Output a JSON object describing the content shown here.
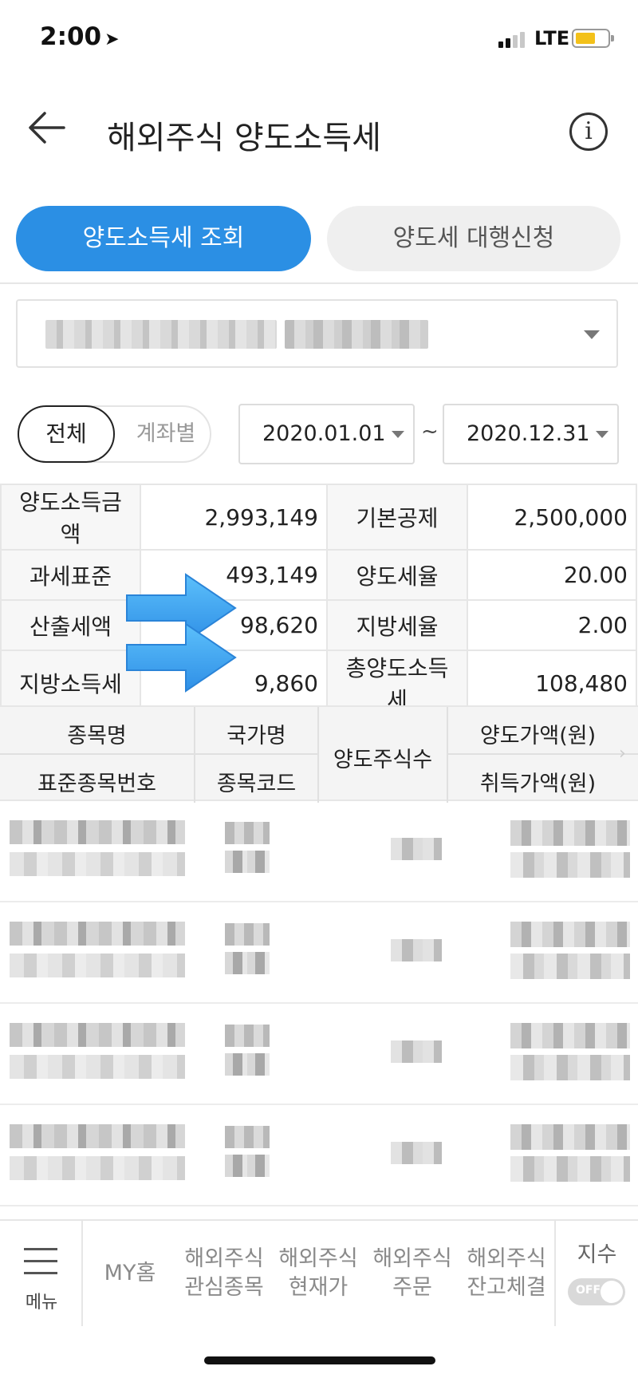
{
  "status": {
    "time": "2:00",
    "network": "LTE"
  },
  "header": {
    "title": "해외주식 양도소득세"
  },
  "tabs": {
    "inquiry": "양도소득세 조회",
    "agency": "양도세 대행신청"
  },
  "filter": {
    "all": "전체",
    "by_account": "계좌별",
    "date_from": "2020.01.01",
    "date_separator": "~",
    "date_to": "2020.12.31"
  },
  "summary": {
    "rows": [
      {
        "l1": "양도소득금액",
        "v1": "2,993,149",
        "l2": "기본공제",
        "v2": "2,500,000"
      },
      {
        "l1": "과세표준",
        "v1": "493,149",
        "l2": "양도세율",
        "v2": "20.00"
      },
      {
        "l1": "산출세액",
        "v1": "98,620",
        "l2": "지방세율",
        "v2": "2.00"
      },
      {
        "l1": "지방소득세",
        "v1": "9,860",
        "l2": "총양도소득세",
        "v2": "108,480"
      }
    ]
  },
  "holdings_header": {
    "name": "종목명",
    "country": "국가명",
    "quantity": "양도주식수",
    "sell_amount": "양도가액(원)",
    "std_code": "표준종목번호",
    "code": "종목코드",
    "buy_amount": "취득가액(원)"
  },
  "bottom_nav": {
    "menu": "메뉴",
    "my_home": "MY홈",
    "watchlist": [
      "해외주식",
      "관심종목"
    ],
    "quote": [
      "해외주식",
      "현재가"
    ],
    "order": [
      "해외주식",
      "주문"
    ],
    "balance": [
      "해외주식",
      "잔고체결"
    ],
    "index": "지수",
    "index_toggle": "OFF"
  },
  "colors": {
    "accent": "#2b8fe4",
    "arrow": "#3aa3f0"
  }
}
